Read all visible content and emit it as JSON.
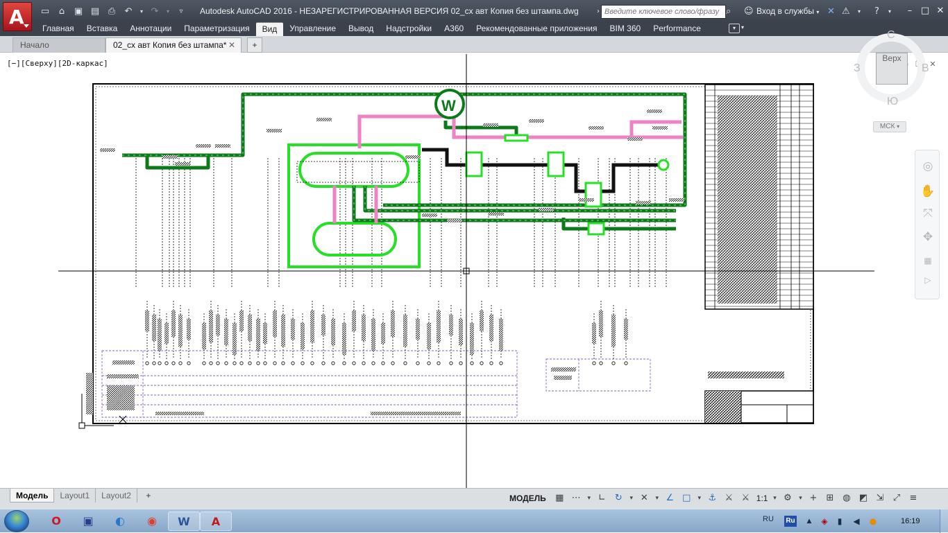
{
  "app": {
    "logo_letter": "A",
    "title": "Autodesk AutoCAD 2016 - НЕЗАРЕГИСТРИРОВАННАЯ ВЕРСИЯ    02_сх авт Копия без штампа.dwg"
  },
  "search": {
    "placeholder": "Введите ключевое слово/фразу"
  },
  "signin": {
    "label": "Вход в службы"
  },
  "ribbon": {
    "tabs": [
      "Главная",
      "Вставка",
      "Аннотации",
      "Параметризация",
      "Вид",
      "Управление",
      "Вывод",
      "Надстройки",
      "A360",
      "Рекомендованные приложения",
      "BIM 360",
      "Performance"
    ],
    "active_tab": "Вид"
  },
  "file_tabs": {
    "start": "Начало",
    "drawing": "02_сх авт Копия без штампа*"
  },
  "viewport": {
    "label": "[−][Сверху][2D-каркас]"
  },
  "viewcube": {
    "face": "Верх",
    "north": "С",
    "south": "Ю",
    "west": "З",
    "east": "В",
    "wcs": "МСК"
  },
  "layout_tabs": [
    "Модель",
    "Layout1",
    "Layout2"
  ],
  "status": {
    "model": "МОДЕЛЬ",
    "scale": "1:1"
  },
  "taskbar": {
    "lang": "RU",
    "lang_badge": "Ru",
    "time": "16:19"
  },
  "colors": {
    "titlebar": "#3b424c",
    "pipe_dark_green": "#0d7a1a",
    "pipe_light_green": "#26e026",
    "pipe_pink": "#ee82c4",
    "pipe_black": "#111111",
    "legend_border": "#8a63c9",
    "accent_blue": "#1f6fc4"
  }
}
